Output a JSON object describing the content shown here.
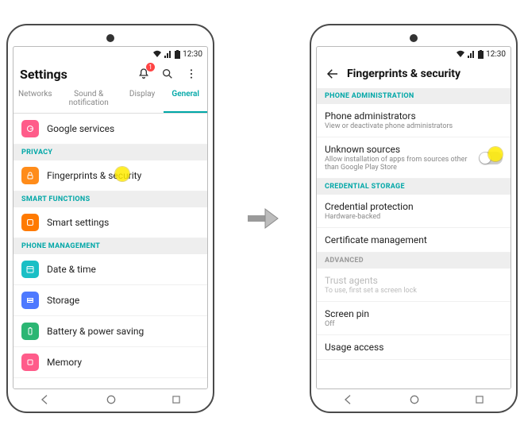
{
  "captions": {
    "left": "",
    "right": ""
  },
  "status": {
    "time": "12:30"
  },
  "phone1": {
    "title": "Settings",
    "notif_badge": "1",
    "tabs": {
      "networks": "Networks",
      "sound": "Sound & notification",
      "display": "Display",
      "general": "General"
    },
    "rows": {
      "google": "Google services",
      "fps": "Fingerprints & security",
      "smart": "Smart settings",
      "date": "Date & time",
      "storage": "Storage",
      "battery": "Battery & power saving",
      "memory": "Memory"
    },
    "sections": {
      "privacy": "PRIVACY",
      "smartfn": "SMART FUNCTIONS",
      "phonemgmt": "PHONE MANAGEMENT"
    }
  },
  "phone2": {
    "title": "Fingerprints & security",
    "sections": {
      "admin": "PHONE ADMINISTRATION",
      "cred": "CREDENTIAL STORAGE",
      "adv": "ADVANCED"
    },
    "rows": {
      "phoneadmin": {
        "t": "Phone administrators",
        "s": "View or deactivate phone administrators"
      },
      "unknown": {
        "t": "Unknown sources",
        "s": "Allow installation of apps from sources other than Google Play Store"
      },
      "credprot": {
        "t": "Credential protection",
        "s": "Hardware-backed"
      },
      "certmgmt": {
        "t": "Certificate management",
        "s": ""
      },
      "trust": {
        "t": "Trust agents",
        "s": "To use, first set a screen lock"
      },
      "screenpin": {
        "t": "Screen pin",
        "s": "Off"
      },
      "usage": {
        "t": "Usage access",
        "s": ""
      }
    }
  }
}
